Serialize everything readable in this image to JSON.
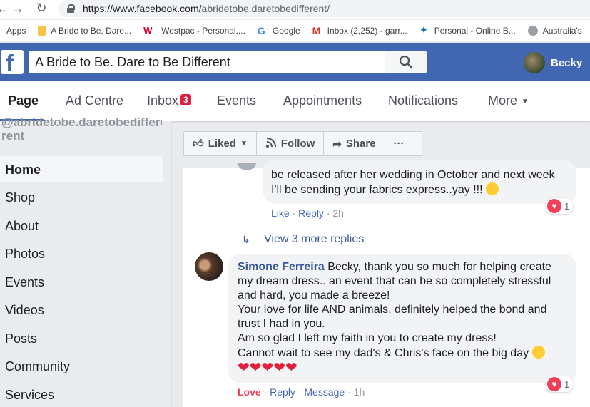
{
  "browser": {
    "back_icon": "←",
    "forward_icon": "→",
    "reload_icon": "↻",
    "url_prefix": "https://www.facebook.com/",
    "url_path": "abridetobe.daretobedifferent/",
    "bookmarks": [
      {
        "label": "Apps",
        "icon": "apps-icon",
        "color": "#5f6368"
      },
      {
        "label": "A Bride to Be, Dare...",
        "icon": "folder-icon",
        "color": "#f6c445"
      },
      {
        "label": "Westpac - Personal,...",
        "icon": "westpac-icon",
        "color": "#d5002b"
      },
      {
        "label": "Google",
        "icon": "google-icon",
        "color": "#4285f4"
      },
      {
        "label": "Inbox (2,252) - garr...",
        "icon": "gmail-icon",
        "color": "#d93025"
      },
      {
        "label": "Personal - Online B...",
        "icon": "bank-icon",
        "color": "#0a6ebd"
      },
      {
        "label": "Australia's",
        "icon": "globe-icon",
        "color": "#5f6368"
      }
    ]
  },
  "fb": {
    "logo": "f",
    "search_value": "A Bride to Be. Dare to Be Different",
    "profile_name": "Becky",
    "brand_color": "#4267b2"
  },
  "tabs": {
    "page": "Page",
    "ad_centre": "Ad Centre",
    "inbox": "Inbox",
    "inbox_badge": "3",
    "events": "Events",
    "appointments": "Appointments",
    "notifications": "Notifications",
    "more": "More"
  },
  "sidebar": {
    "handle_line1": "@abridetobe.daretobedifferent",
    "handle_line2": "rent",
    "items": [
      {
        "label": "Home"
      },
      {
        "label": "Shop"
      },
      {
        "label": "About"
      },
      {
        "label": "Photos"
      },
      {
        "label": "Events"
      },
      {
        "label": "Videos"
      },
      {
        "label": "Posts"
      },
      {
        "label": "Community"
      },
      {
        "label": "Services"
      }
    ]
  },
  "actions": {
    "liked": "Liked",
    "follow": "Follow",
    "share": "Share",
    "more": "···"
  },
  "comment1": {
    "line1": "be released after her wedding in October and next week",
    "line2": "I'll be sending your fabrics express..yay !!!",
    "like": "Like",
    "reply": "Reply",
    "time": "2h",
    "reaction_count": "1"
  },
  "view_replies": "View 3 more replies",
  "comment2": {
    "author": "Simone Ferreira",
    "lines": [
      "Becky, thank you so much for helping create",
      "my dream dress.. an event that can be so completely stressful",
      "and hard, you made a breeze!",
      "Your love for life AND animals, definitely helped the bond and",
      "trust I had in you.",
      "Am so glad I left my faith in you to create my dress!",
      "Cannot wait to see my dad's & Chris's face on the big day"
    ],
    "hearts": "❤❤❤❤❤",
    "love": "Love",
    "reply": "Reply",
    "message": "Message",
    "time": "1h",
    "reaction_count": "1"
  }
}
